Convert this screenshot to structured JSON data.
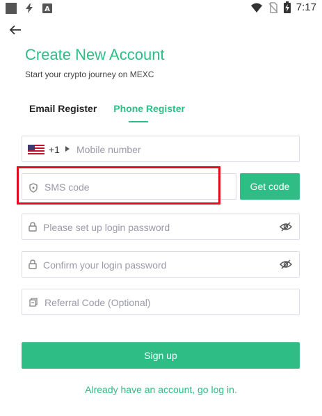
{
  "status_bar": {
    "time": "7:17",
    "icons": [
      "square-icon",
      "flash-icon",
      "text-a-icon",
      "wifi-icon",
      "no-sim-icon",
      "battery-icon"
    ]
  },
  "header": {
    "back_icon": "arrow-left-icon",
    "title": "Create New Account",
    "subtitle": "Start your crypto journey on MEXC"
  },
  "tabs": [
    {
      "label": "Email Register",
      "active": false
    },
    {
      "label": "Phone Register",
      "active": true
    }
  ],
  "form": {
    "mobile": {
      "flag": "us-flag-icon",
      "country_code": "+1",
      "placeholder": "Mobile number"
    },
    "sms": {
      "placeholder": "SMS code",
      "get_code_label": "Get code"
    },
    "password": {
      "placeholder": "Please set up login password"
    },
    "confirm_password": {
      "placeholder": "Confirm your login password"
    },
    "referral": {
      "placeholder": "Referral Code (Optional)"
    }
  },
  "actions": {
    "signup_label": "Sign up",
    "login_link": "Already have an account, go log in."
  },
  "colors": {
    "accent": "#2dbd85",
    "highlight": "#e10c1c",
    "border": "#dcdce8",
    "placeholder": "#9a9aaa"
  }
}
